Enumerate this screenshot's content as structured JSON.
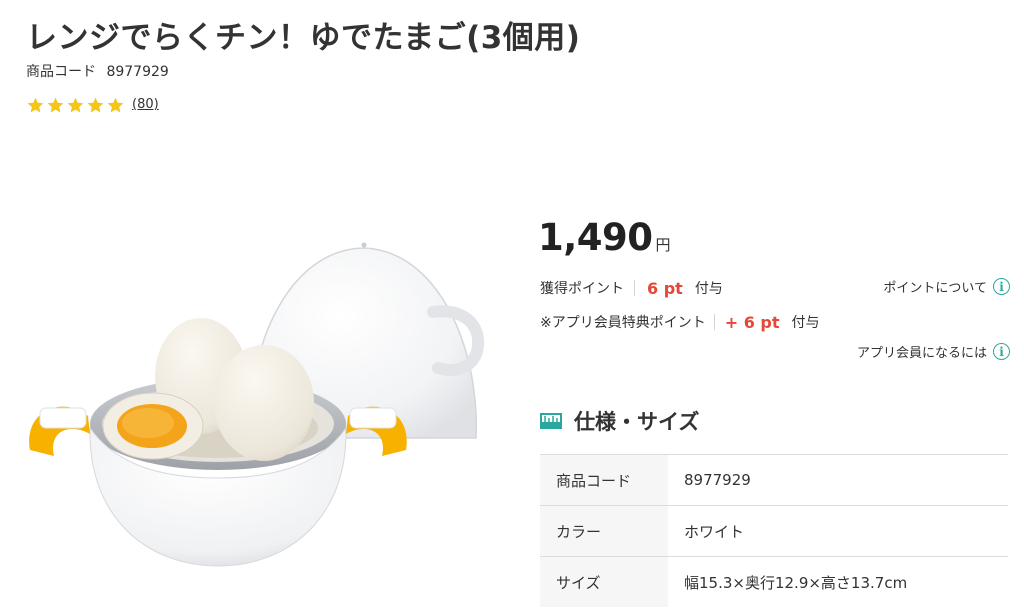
{
  "product": {
    "title": "レンジでらくチン！ゆでたまご(3個用)",
    "code_label": "商品コード",
    "code": "8977929",
    "rating": {
      "stars": 5,
      "review_count": "(80)"
    }
  },
  "price": {
    "value": "1,490",
    "unit": "円"
  },
  "points": {
    "label": "獲得ポイント",
    "value": "6 pt",
    "suffix": "付与",
    "about_link": "ポイントについて",
    "app_label": "※アプリ会員特典ポイント",
    "app_value": "+ 6 pt",
    "app_suffix": "付与",
    "app_link": "アプリ会員になるには"
  },
  "specs": {
    "title": "仕様・サイズ",
    "rows": [
      {
        "key": "商品コード",
        "value": "8977929"
      },
      {
        "key": "カラー",
        "value": "ホワイト"
      },
      {
        "key": "サイズ",
        "value": "幅15.3×奥行12.9×高さ13.7cm"
      }
    ]
  },
  "colors": {
    "star": "#f5c518",
    "point_red": "#e4483a",
    "info_teal": "#2aa8a0",
    "egg_yolk": "#f4a41a"
  },
  "icons": {
    "star": "star-icon",
    "info": "info-icon",
    "ruler": "ruler-icon"
  }
}
